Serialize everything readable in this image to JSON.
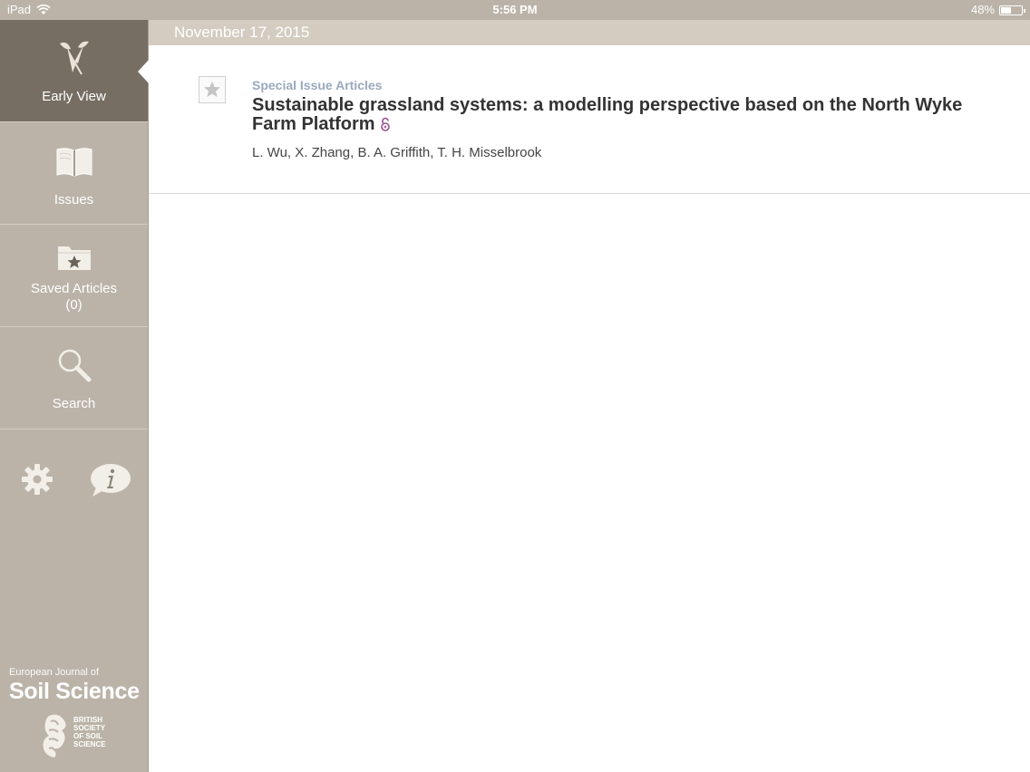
{
  "status_bar": {
    "device": "iPad",
    "time": "5:56 PM",
    "battery": "48%",
    "battery_level": 0.48
  },
  "sidebar": {
    "items": [
      {
        "label": "Early View",
        "icon": "early-view-icon",
        "active": true
      },
      {
        "label": "Issues",
        "icon": "book-icon",
        "active": false
      },
      {
        "label": "Saved Articles\n(0)",
        "icon": "folder-star-icon",
        "active": false
      },
      {
        "label": "Search",
        "icon": "search-icon",
        "active": false
      }
    ],
    "utility": [
      "gear-icon",
      "info-icon"
    ],
    "brand": {
      "pre": "European Journal of",
      "title": "Soil Science"
    },
    "society": [
      "BRITISH",
      "SOCIETY",
      "OF SOIL",
      "SCIENCE"
    ]
  },
  "content": {
    "date": "November 17, 2015",
    "articles": [
      {
        "section": "Special Issue Articles",
        "title": "Sustainable grassland systems: a modelling perspective based on the North Wyke Farm Platform",
        "authors": "L. Wu, X. Zhang, B. A. Griffith, T. H. Misselbrook",
        "open_access": true
      }
    ]
  },
  "colors": {
    "sidebar": "#bbb3a8",
    "sidebar_active": "#776e63",
    "section_label": "#9aa9bd",
    "open_access": "#9b4d8f"
  }
}
